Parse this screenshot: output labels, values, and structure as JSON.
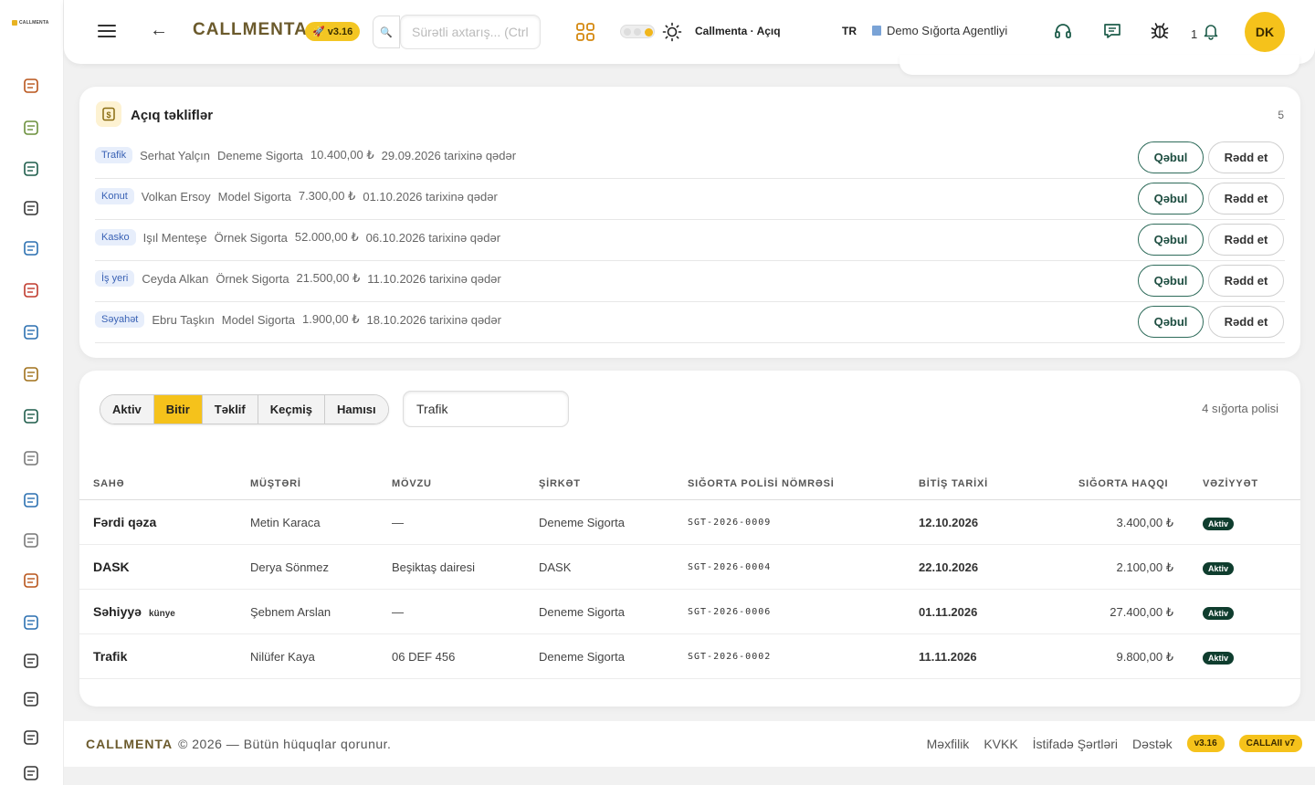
{
  "brand": {
    "logo_text": "CALLMENTA",
    "name": "CALLMENTA",
    "version": "v3.16"
  },
  "header": {
    "search_placeholder": "Sürətli axtarış... (Ctrl+K)",
    "status": "Callmenta · Açıq",
    "language": "TR",
    "agency": "Demo Sığorta Agentliyi",
    "notification_count": "1",
    "avatar_initials": "DK"
  },
  "offers": {
    "title": "Açıq təkliflər",
    "count": "5",
    "accept_label": "Qəbul",
    "reject_label": "Rədd et",
    "items": [
      {
        "tag": "Trafik",
        "client": "Serhat Yalçın",
        "company": "Deneme Sigorta",
        "amount": "10.400,00 ₺",
        "until": "29.09.2026 tarixinə qədər"
      },
      {
        "tag": "Konut",
        "client": "Volkan Ersoy",
        "company": "Model Sigorta",
        "amount": "7.300,00 ₺",
        "until": "01.10.2026 tarixinə qədər"
      },
      {
        "tag": "Kasko",
        "client": "Işıl Menteşe",
        "company": "Örnek Sigorta",
        "amount": "52.000,00 ₺",
        "until": "06.10.2026 tarixinə qədər"
      },
      {
        "tag": "İş yeri",
        "client": "Ceyda Alkan",
        "company": "Örnek Sigorta",
        "amount": "21.500,00 ₺",
        "until": "11.10.2026 tarixinə qədər"
      },
      {
        "tag": "Səyahət",
        "client": "Ebru Taşkın",
        "company": "Model Sigorta",
        "amount": "1.900,00 ₺",
        "until": "18.10.2026 tarixinə qədər"
      }
    ]
  },
  "policies": {
    "tabs": [
      "Aktiv",
      "Bitir",
      "Təklif",
      "Keçmiş",
      "Hamısı"
    ],
    "active_tab": "Bitir",
    "filter_value": "Trafik",
    "count": "4 sığorta polisi",
    "columns": [
      "SAHƏ",
      "MÜŞTƏRİ",
      "MÖVZU",
      "ŞİRKƏT",
      "SIĞORTA POLİSİ NÖMRƏSİ",
      "BİTİŞ TARİXİ",
      "SIĞORTA HAQQI",
      "VƏZİYYƏT"
    ],
    "rows": [
      {
        "field": "Fərdi qəza",
        "sub": "",
        "client": "Metin Karaca",
        "subject": "—",
        "company": "Deneme Sigorta",
        "number": "SGT-2026-0009",
        "end": "12.10.2026",
        "premium": "3.400,00 ₺",
        "status": "Aktiv"
      },
      {
        "field": "DASK",
        "sub": "",
        "client": "Derya Sönmez",
        "subject": "Beşiktaş dairesi",
        "company": "DASK",
        "number": "SGT-2026-0004",
        "end": "22.10.2026",
        "premium": "2.100,00 ₺",
        "status": "Aktiv"
      },
      {
        "field": "Səhiyyə",
        "sub": "künye",
        "client": "Şebnem Arslan",
        "subject": "—",
        "company": "Deneme Sigorta",
        "number": "SGT-2026-0006",
        "end": "01.11.2026",
        "premium": "27.400,00 ₺",
        "status": "Aktiv"
      },
      {
        "field": "Trafik",
        "sub": "",
        "client": "Nilüfer Kaya",
        "subject": "06 DEF 456",
        "company": "Deneme Sigorta",
        "number": "SGT-2026-0002",
        "end": "11.11.2026",
        "premium": "9.800,00 ₺",
        "status": "Aktiv"
      }
    ]
  },
  "footer": {
    "brand": "CALLMENTA",
    "copyright": "© 2026 — Bütün hüquqlar qorunur.",
    "links": [
      "Məxfilik",
      "KVKK",
      "İstifadə Şərtləri",
      "Dəstək"
    ],
    "version": "v3.16",
    "ai_badge": "CALLAII v7"
  },
  "sidebar_icons": [
    "dashboard-icon",
    "clipboard-icon",
    "id-card-icon",
    "code-brackets-icon",
    "user-circle-icon",
    "alarm-clock-icon",
    "user-chat-icon",
    "medal-icon",
    "megaphone-icon",
    "settings-gear-icon",
    "calendar-grid-icon",
    "shield-icon",
    "building-icon",
    "line-chart-icon",
    "globe-icon",
    "list-settings-icon",
    "bar-chart-icon",
    "warning-icon"
  ],
  "colors": {
    "accent": "#f5c21b",
    "brand_text": "#6b5a2c",
    "status_active": "#0f3d2e",
    "tag_bg": "#e7eefb"
  }
}
